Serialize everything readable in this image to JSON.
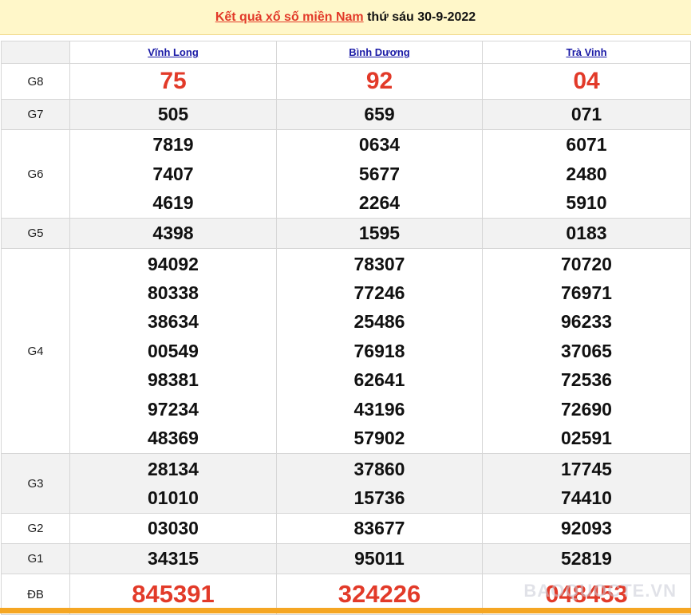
{
  "header": {
    "title_link": "Kết quả xổ số miền Nam",
    "title_rest": " thứ sáu 30-9-2022"
  },
  "provinces": [
    "Vĩnh Long",
    "Bình Dương",
    "Trà Vinh"
  ],
  "prizes": [
    {
      "label": "G8",
      "values": [
        [
          "75"
        ],
        [
          "92"
        ],
        [
          "04"
        ]
      ]
    },
    {
      "label": "G7",
      "values": [
        [
          "505"
        ],
        [
          "659"
        ],
        [
          "071"
        ]
      ]
    },
    {
      "label": "G6",
      "values": [
        [
          "7819",
          "7407",
          "4619"
        ],
        [
          "0634",
          "5677",
          "2264"
        ],
        [
          "6071",
          "2480",
          "5910"
        ]
      ]
    },
    {
      "label": "G5",
      "values": [
        [
          "4398"
        ],
        [
          "1595"
        ],
        [
          "0183"
        ]
      ]
    },
    {
      "label": "G4",
      "values": [
        [
          "94092",
          "80338",
          "38634",
          "00549",
          "98381",
          "97234",
          "48369"
        ],
        [
          "78307",
          "77246",
          "25486",
          "76918",
          "62641",
          "43196",
          "57902"
        ],
        [
          "70720",
          "76971",
          "96233",
          "37065",
          "72536",
          "72690",
          "02591"
        ]
      ]
    },
    {
      "label": "G3",
      "values": [
        [
          "28134",
          "01010"
        ],
        [
          "37860",
          "15736"
        ],
        [
          "17745",
          "74410"
        ]
      ]
    },
    {
      "label": "G2",
      "values": [
        [
          "03030"
        ],
        [
          "83677"
        ],
        [
          "92093"
        ]
      ]
    },
    {
      "label": "G1",
      "values": [
        [
          "34315"
        ],
        [
          "95011"
        ],
        [
          "52819"
        ]
      ]
    },
    {
      "label": "ĐB",
      "values": [
        [
          "845391"
        ],
        [
          "324226"
        ],
        [
          "048453"
        ]
      ]
    }
  ],
  "watermark": "BAOQUOCTE.VN",
  "colors": {
    "accent_red": "#e23a29",
    "link_blue": "#1a1aa6",
    "title_bg": "#fff7c9",
    "footer": "#f5a623"
  }
}
